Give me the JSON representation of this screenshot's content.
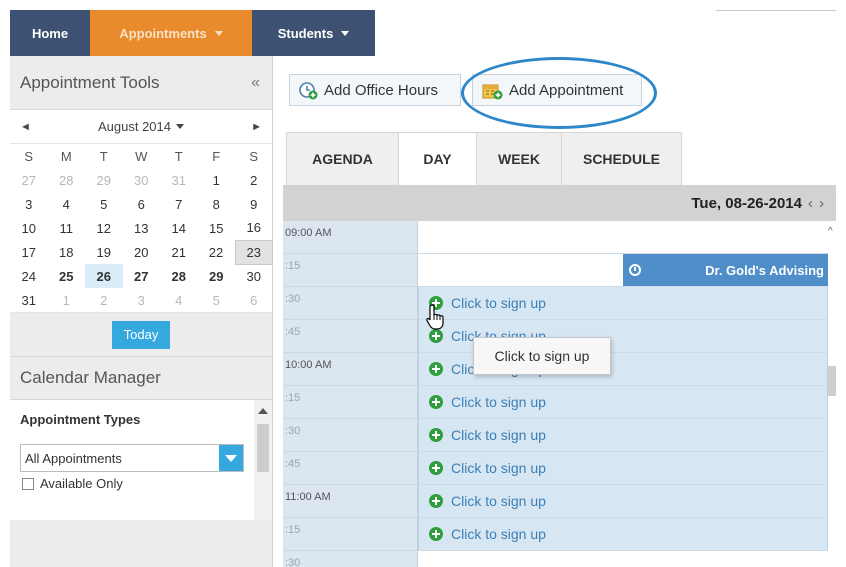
{
  "nav": {
    "home": "Home",
    "appointments": "Appointments",
    "students": "Students"
  },
  "left_panel": {
    "title": "Appointment Tools",
    "collapse": "«",
    "calendar": {
      "prev": "◄",
      "next": "►",
      "month": "August 2014",
      "weekdays": [
        "S",
        "M",
        "T",
        "W",
        "T",
        "F",
        "S"
      ],
      "weeks": [
        [
          "27",
          "28",
          "29",
          "30",
          "31",
          "1",
          "2"
        ],
        [
          "3",
          "4",
          "5",
          "6",
          "7",
          "8",
          "9"
        ],
        [
          "10",
          "11",
          "12",
          "13",
          "14",
          "15",
          "16"
        ],
        [
          "17",
          "18",
          "19",
          "20",
          "21",
          "22",
          "23"
        ],
        [
          "24",
          "25",
          "26",
          "27",
          "28",
          "29",
          "30"
        ],
        [
          "31",
          "1",
          "2",
          "3",
          "4",
          "5",
          "6"
        ]
      ],
      "today_button": "Today"
    },
    "calendar_manager": "Calendar Manager",
    "appointment_types": {
      "title": "Appointment Types",
      "selected": "All Appointments",
      "available_only": "Available Only"
    }
  },
  "toolbar": {
    "add_office_hours": "Add Office Hours",
    "add_appointment": "Add Appointment"
  },
  "tabs": [
    "AGENDA",
    "DAY",
    "WEEK",
    "SCHEDULE"
  ],
  "active_tab": "DAY",
  "date_bar": {
    "date": "Tue, 08-26-2014",
    "prev": "‹",
    "next": "›"
  },
  "time_rows": [
    "09:00 AM",
    ":15",
    ":30",
    ":45",
    "10:00 AM",
    ":15",
    ":30",
    ":45",
    "11:00 AM",
    ":15",
    ":30"
  ],
  "slot_label": "Click to sign up",
  "event": {
    "title": "Dr. Gold's Advising"
  },
  "tooltip": "Click to sign up",
  "colors": {
    "nav_dark": "#3d5272",
    "nav_orange": "#e98a2c",
    "accent_blue": "#35a8e0",
    "event_blue": "#4f8ec9",
    "slot_bg": "#d7e6f3",
    "plus_green": "#2f9e3d",
    "highlight_oval": "#2e87c8"
  },
  "icons": [
    "caret-down-icon",
    "calendar-plus-icon",
    "gift-calendar-icon",
    "plus-circle-icon",
    "clock-icon",
    "hand-cursor-icon"
  ]
}
